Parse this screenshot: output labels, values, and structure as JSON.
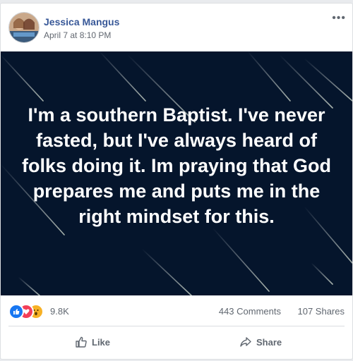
{
  "post": {
    "author": "Jessica Mangus",
    "timestamp": "April 7 at 8:10 PM",
    "more_label": "•••",
    "media_text": "I'm a southern Baptist. I've never fasted, but I've always heard of folks doing it. Im praying that God prepares me and puts me in the right mindset for this."
  },
  "stats": {
    "reactions": [
      "like-reaction-icon",
      "love-reaction-icon",
      "wow-reaction-icon"
    ],
    "reaction_count": "9.8K",
    "comments": "443 Comments",
    "shares": "107 Shares"
  },
  "actions": {
    "like_label": "Like",
    "share_label": "Share"
  },
  "colors": {
    "author": "#385898",
    "media_background": "#05152c",
    "like_blue": "#1877f2",
    "love_red": "#f33e58",
    "wow_yellow": "#f7b125"
  }
}
